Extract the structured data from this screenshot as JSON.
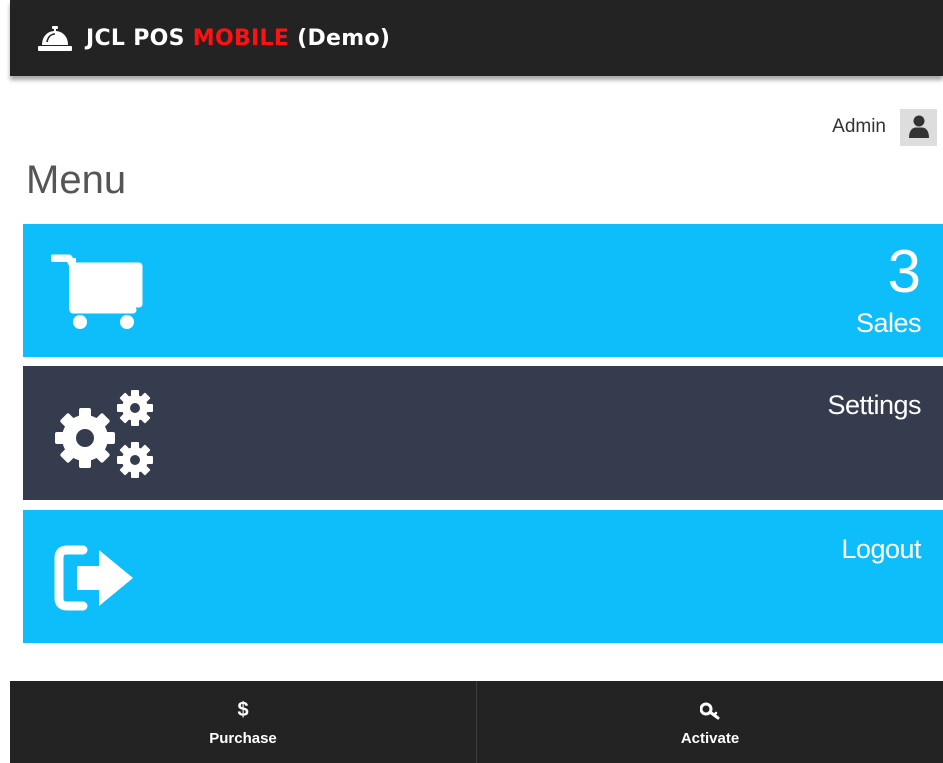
{
  "header": {
    "brand_part1": "JCL POS ",
    "brand_part2": "MOBILE",
    "brand_part3": " (Demo)",
    "brand_icon": "service-bell-icon"
  },
  "user": {
    "name": "Admin",
    "icon": "user-icon"
  },
  "page": {
    "title": "Menu"
  },
  "tiles": {
    "sales": {
      "count": "3",
      "label": "Sales",
      "icon": "shopping-cart-icon"
    },
    "settings": {
      "label": "Settings",
      "icon": "gears-icon"
    },
    "logout": {
      "label": "Logout",
      "icon": "sign-out-icon"
    }
  },
  "bottom": {
    "purchase": {
      "icon_glyph": "$",
      "label": "Purchase"
    },
    "activate": {
      "label": "Activate",
      "icon": "key-icon"
    }
  },
  "colors": {
    "topbar": "#232323",
    "tile_accent": "#0ebefb",
    "tile_dark": "#353c4d",
    "brand_highlight": "#ff1111"
  }
}
